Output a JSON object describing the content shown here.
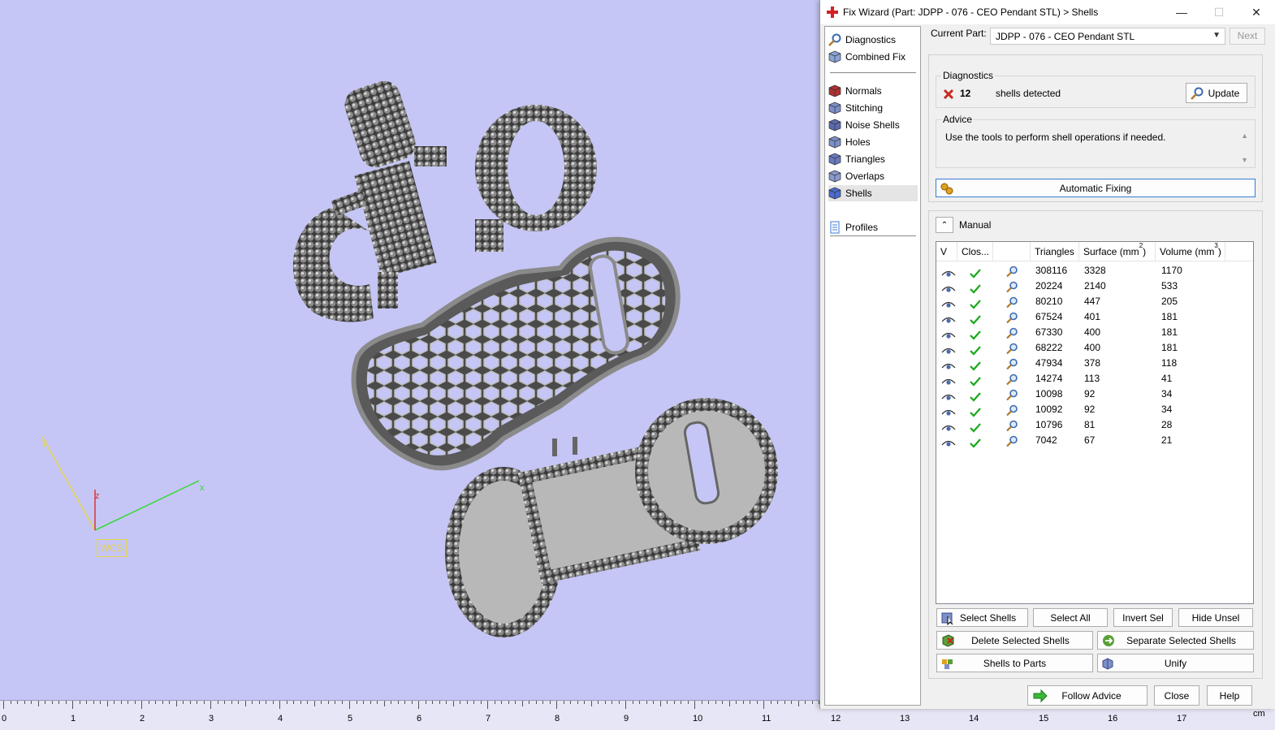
{
  "window": {
    "title": "Fix Wizard (Part: JDPP - 076 - CEO Pendant STL) > Shells",
    "minimize": "—",
    "maximize": "☐",
    "close": "✕"
  },
  "nav": {
    "items": [
      {
        "label": "Diagnostics",
        "icon": "diagnostics-icon"
      },
      {
        "label": "Combined Fix",
        "icon": "combined-fix-icon"
      },
      {
        "label": "Normals",
        "icon": "normals-icon"
      },
      {
        "label": "Stitching",
        "icon": "stitching-icon"
      },
      {
        "label": "Noise Shells",
        "icon": "noise-shells-icon"
      },
      {
        "label": "Holes",
        "icon": "holes-icon"
      },
      {
        "label": "Triangles",
        "icon": "triangles-icon"
      },
      {
        "label": "Overlaps",
        "icon": "overlaps-icon"
      },
      {
        "label": "Shells",
        "icon": "shells-icon",
        "selected": true
      },
      {
        "label": "Profiles",
        "icon": "profiles-icon"
      }
    ]
  },
  "header": {
    "current_part_label": "Current Part:",
    "current_part_value": "JDPP - 076 - CEO Pendant STL",
    "next_label": "Next"
  },
  "diagnostics": {
    "title": "Diagnostics",
    "count": "12",
    "message": "shells detected",
    "update_label": "Update"
  },
  "advice": {
    "title": "Advice",
    "text": "Use the tools to perform shell operations if needed."
  },
  "automatic_fixing_label": "Automatic Fixing",
  "manual_label": "Manual",
  "table": {
    "columns": [
      "V",
      "Clos...",
      "",
      "Triangles",
      "Surface (mm",
      "Volume (mm"
    ],
    "superscript": "2",
    "superscript3": "3",
    "rows": [
      {
        "triangles": "308116",
        "surface": "3328",
        "volume": "1170"
      },
      {
        "triangles": "20224",
        "surface": "2140",
        "volume": "533"
      },
      {
        "triangles": "80210",
        "surface": "447",
        "volume": "205"
      },
      {
        "triangles": "67524",
        "surface": "401",
        "volume": "181"
      },
      {
        "triangles": "67330",
        "surface": "400",
        "volume": "181"
      },
      {
        "triangles": "68222",
        "surface": "400",
        "volume": "181"
      },
      {
        "triangles": "47934",
        "surface": "378",
        "volume": "118"
      },
      {
        "triangles": "14274",
        "surface": "113",
        "volume": "41"
      },
      {
        "triangles": "10098",
        "surface": "92",
        "volume": "34"
      },
      {
        "triangles": "10092",
        "surface": "92",
        "volume": "34"
      },
      {
        "triangles": "10796",
        "surface": "81",
        "volume": "28"
      },
      {
        "triangles": "7042",
        "surface": "67",
        "volume": "21"
      }
    ]
  },
  "buttons": {
    "select_shells": "Select Shells",
    "select_all": "Select All",
    "invert_sel": "Invert Sel",
    "hide_unsel": "Hide Unsel",
    "delete_selected": "Delete Selected Shells",
    "separate_selected": "Separate Selected Shells",
    "shells_to_parts": "Shells to Parts",
    "unify": "Unify",
    "follow_advice": "Follow Advice",
    "close": "Close",
    "help": "Help"
  },
  "viewport": {
    "wcs_label": "WCS",
    "axis_x": "x",
    "axis_y": "y",
    "axis_z": "z",
    "ruler_unit": "cm",
    "ruler_numbers": [
      "0",
      "1",
      "2",
      "3",
      "4",
      "5",
      "6",
      "7",
      "8",
      "9",
      "10",
      "11",
      "12",
      "13",
      "14",
      "15",
      "16",
      "17"
    ],
    "background_color": "#c5c6f5"
  }
}
